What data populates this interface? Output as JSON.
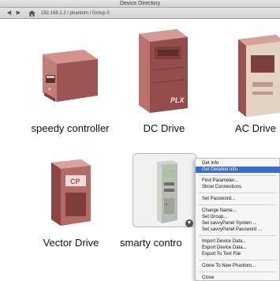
{
  "window": {
    "title": "Device Directory"
  },
  "toolbar": {
    "back_icon": "left-arrow-icon",
    "forward_icon": "right-arrow-icon",
    "home_icon": "home-icon",
    "path": "192.168.1.2 / phantom / Group 0"
  },
  "devices": [
    {
      "label": "speedy controller"
    },
    {
      "label": "DC Drive",
      "brand": "PLX"
    },
    {
      "label": "AC Drive"
    },
    {
      "label": "Vector Drive"
    },
    {
      "label": "smarty contro"
    }
  ],
  "context_menu": {
    "items": [
      {
        "label": "Get Info"
      },
      {
        "label": "Get Detailed Info",
        "highlighted": true
      },
      {
        "label": "Find Parameter..."
      },
      {
        "label": "Show Connections"
      },
      {
        "label": "Set Password..."
      },
      {
        "label": "Change Name..."
      },
      {
        "label": "Set Group..."
      },
      {
        "label": "Set savvyPanel System ..."
      },
      {
        "label": "Set savvyPanel Password ..."
      },
      {
        "label": "Import Device Data..."
      },
      {
        "label": "Export Device Data..."
      },
      {
        "label": "Export To Text File"
      },
      {
        "label": "Clone To New Phantom..."
      },
      {
        "label": "Close"
      }
    ]
  },
  "colors": {
    "drive_body": "#a85f5c",
    "drive_dark": "#7d3f3c",
    "menu_highlight": "#3a6ad9"
  }
}
